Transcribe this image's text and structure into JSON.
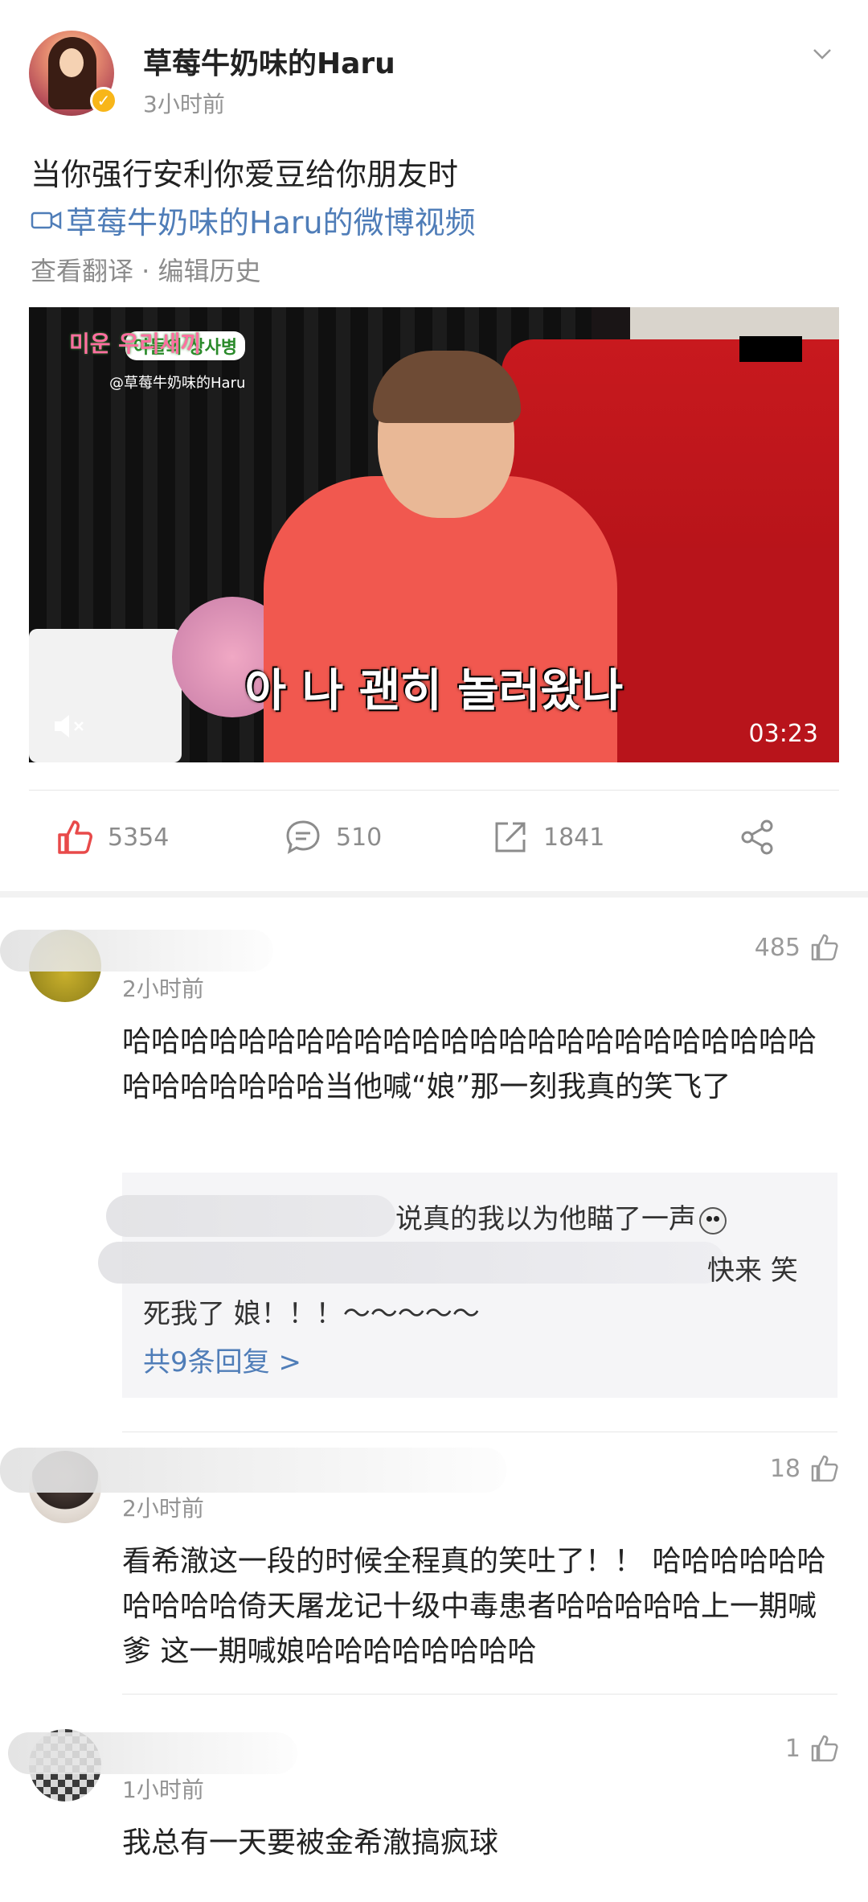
{
  "post": {
    "username": "草莓牛奶味的Haru",
    "time": "3小时前",
    "text": "当你强行安利你爱豆给你朋友时",
    "video_link": "草莓牛奶味的Haru的微博视频",
    "meta": "查看翻译 · 编辑历史",
    "video": {
      "watermark": "@草莓牛奶味的Haru",
      "show_badge": "아들의 상사병",
      "show_logo": "미운 우리새끼",
      "subtitle": "아 나 괜히 놀러왔나",
      "duration": "03:23"
    }
  },
  "actions": {
    "likes": "5354",
    "comments": "510",
    "reposts": "1841"
  },
  "comments": [
    {
      "time": "2小时前",
      "likes": "485",
      "text": "哈哈哈哈哈哈哈哈哈哈哈哈哈哈哈哈哈哈哈哈哈哈哈哈哈哈哈哈哈哈哈当他喊“娘”那一刻我真的笑飞了",
      "replies": {
        "line1": "说真的我以为他瞄了一声",
        "line2": "快来 笑",
        "line3": "死我了 娘！！！～～～～～",
        "more": "共9条回复 >"
      }
    },
    {
      "time": "2小时前",
      "likes": "18",
      "text": "看希澈这一段的时候全程真的笑吐了！！ 哈哈哈哈哈哈哈哈哈哈倚天屠龙记十级中毒患者哈哈哈哈哈上一期喊爹 这一期喊娘哈哈哈哈哈哈哈哈"
    },
    {
      "time": "1小时前",
      "likes": "1",
      "text": "我总有一天要被金希澈搞疯球"
    }
  ],
  "colors": {
    "like_red": "#e84a4a",
    "link_blue": "#4f7db8",
    "verified_gold": "#f8b619"
  }
}
